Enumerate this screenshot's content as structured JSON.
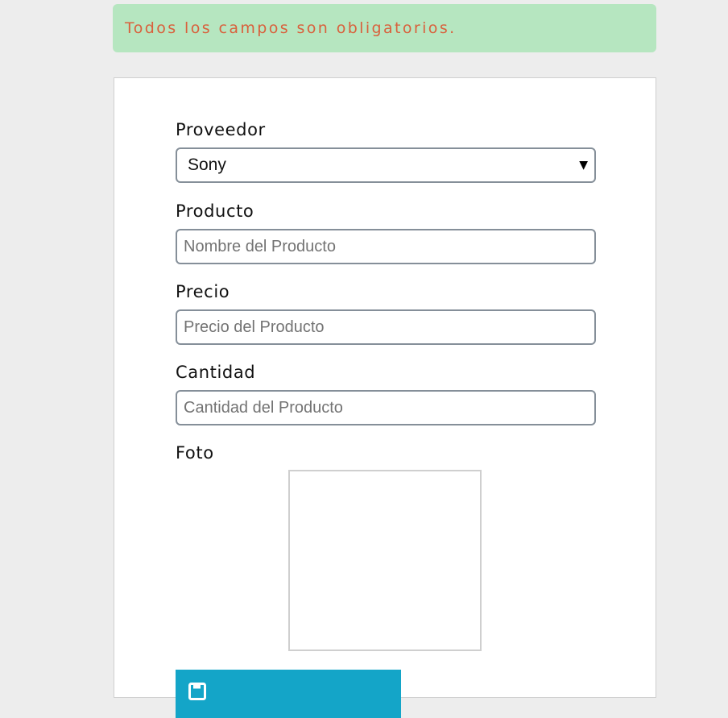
{
  "alert": {
    "message": "Todos los campos son obligatorios."
  },
  "form": {
    "provider": {
      "label": "Proveedor",
      "selected": "Sony"
    },
    "product": {
      "label": "Producto",
      "placeholder": "Nombre del Producto",
      "value": ""
    },
    "price": {
      "label": "Precio",
      "placeholder": "Precio del Producto",
      "value": ""
    },
    "quantity": {
      "label": "Cantidad",
      "placeholder": "Cantidad del Producto",
      "value": ""
    },
    "photo": {
      "label": "Foto"
    },
    "save_button": {
      "icon": "save-icon",
      "color": "#14a5c8"
    }
  },
  "colors": {
    "alert_bg": "#b6e6c0",
    "alert_text": "#d9603c",
    "page_bg": "#ededed",
    "input_border": "#858f99"
  }
}
